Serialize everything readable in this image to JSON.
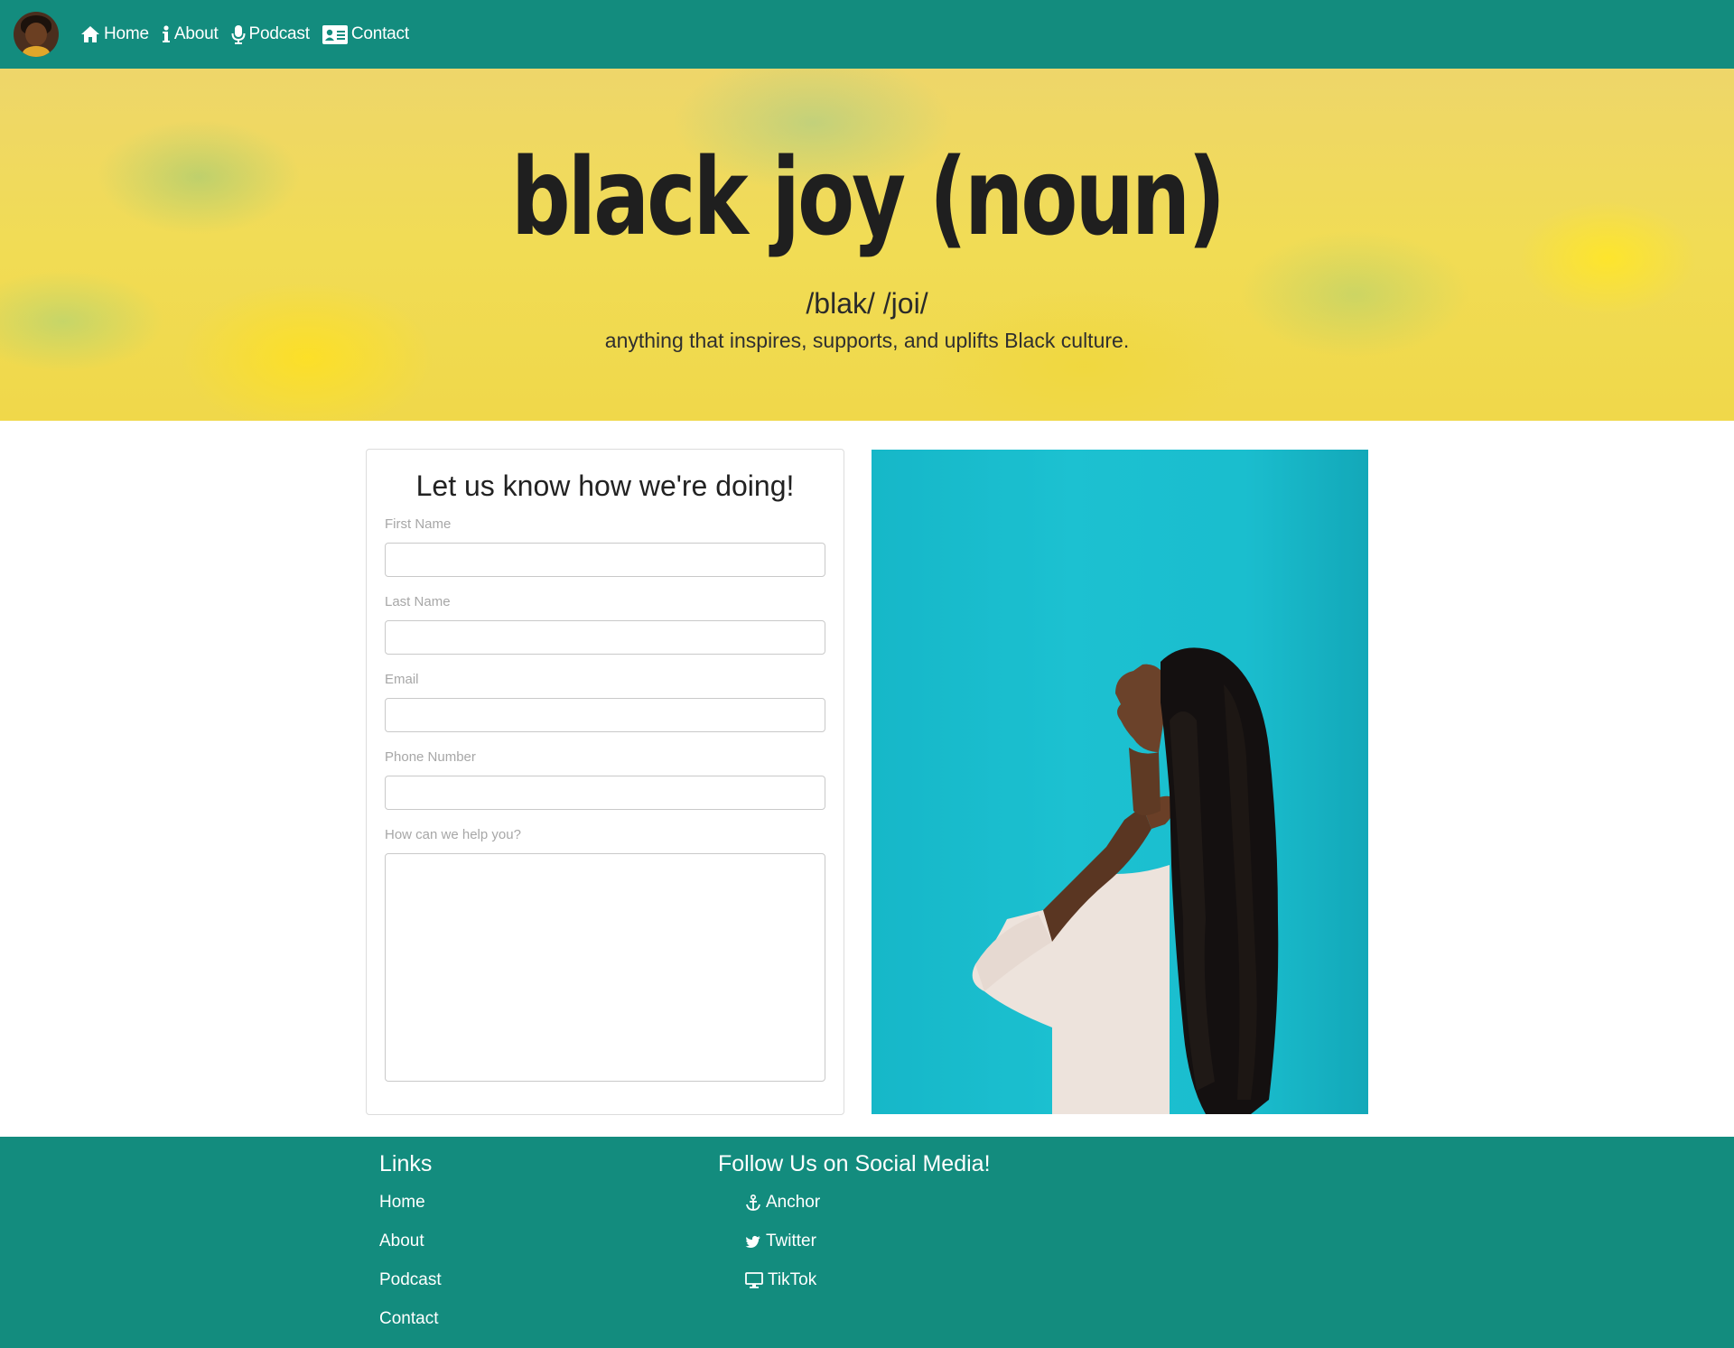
{
  "nav": {
    "items": [
      {
        "label": "Home",
        "icon": "home-icon"
      },
      {
        "label": "About",
        "icon": "info-icon"
      },
      {
        "label": "Podcast",
        "icon": "microphone-icon"
      },
      {
        "label": "Contact",
        "icon": "contact-card-icon"
      }
    ]
  },
  "hero": {
    "title": "black joy (noun)",
    "phonetic": "/blak/ /joi/",
    "subtitle": "anything that inspires, supports, and uplifts Black culture."
  },
  "form": {
    "title": "Let us know how we're doing!",
    "fields": [
      {
        "label": "First Name",
        "value": ""
      },
      {
        "label": "Last Name",
        "value": ""
      },
      {
        "label": "Email",
        "value": ""
      },
      {
        "label": "Phone Number",
        "value": ""
      }
    ],
    "message_label": "How can we help you?",
    "message_value": ""
  },
  "footer": {
    "links_heading": "Links",
    "links": [
      "Home",
      "About",
      "Podcast",
      "Contact"
    ],
    "social_heading": "Follow Us on Social Media!",
    "social": [
      {
        "label": "Anchor",
        "icon": "anchor-icon"
      },
      {
        "label": "Twitter",
        "icon": "twitter-icon"
      },
      {
        "label": "TikTok",
        "icon": "monitor-icon"
      }
    ]
  },
  "colors": {
    "brand_teal": "#138c7e",
    "hero_yellow": "#f0d84a",
    "photo_teal": "#1bc0d0"
  }
}
